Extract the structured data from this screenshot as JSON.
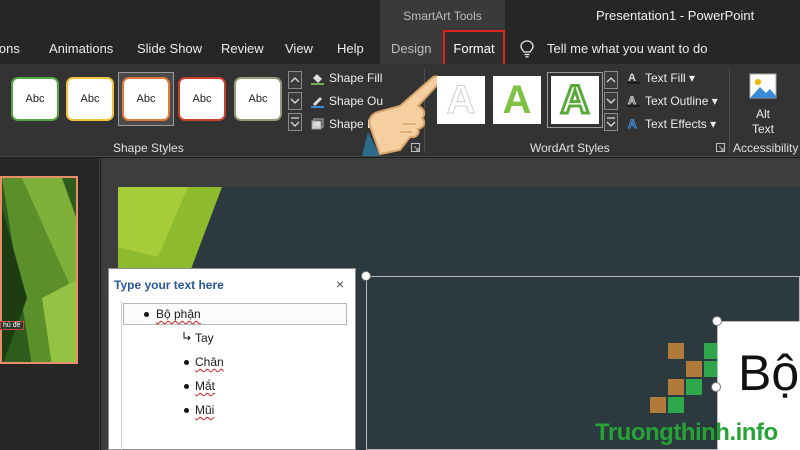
{
  "titlebar": {
    "context_label": "SmartArt Tools",
    "window_title": "Presentation1  -  PowerPoint"
  },
  "tabs": {
    "items": [
      "ions",
      "Animations",
      "Slide Show",
      "Review",
      "View",
      "Help",
      "Design",
      "Format"
    ],
    "active": "Format",
    "tell_me": "Tell me what you want to do"
  },
  "ribbon": {
    "shape_styles": {
      "swatch_label": "Abc",
      "swatch_colors": [
        "#55a546",
        "#f0c43b",
        "#e07b39",
        "#c8412d",
        "#9a9a7a"
      ],
      "commands": [
        "Shape Fill",
        "Shape Ou",
        "Shape E"
      ],
      "group_label": "Shape Styles"
    },
    "wordart_styles": {
      "letter": "A",
      "commands": [
        "Text Fill",
        "Text Outline",
        "Text Effects"
      ],
      "group_label": "WordArt Styles"
    },
    "accessibility": {
      "alt_text": [
        "Alt",
        "Text"
      ],
      "group_label": "Accessibility"
    }
  },
  "text_pane": {
    "title": "Type your text here",
    "close": "×",
    "items": [
      {
        "text": "Bộ phận",
        "level": 1
      },
      {
        "text": "Tay",
        "level": 2
      },
      {
        "text": "Chân",
        "level": 2
      },
      {
        "text": "Mắt",
        "level": 2
      },
      {
        "text": "Mũi",
        "level": 2
      }
    ]
  },
  "thumbnail": {
    "caption": "hủ đề"
  },
  "slide": {
    "big_text": "Bộ"
  },
  "watermark": "Truongthinh.info"
}
